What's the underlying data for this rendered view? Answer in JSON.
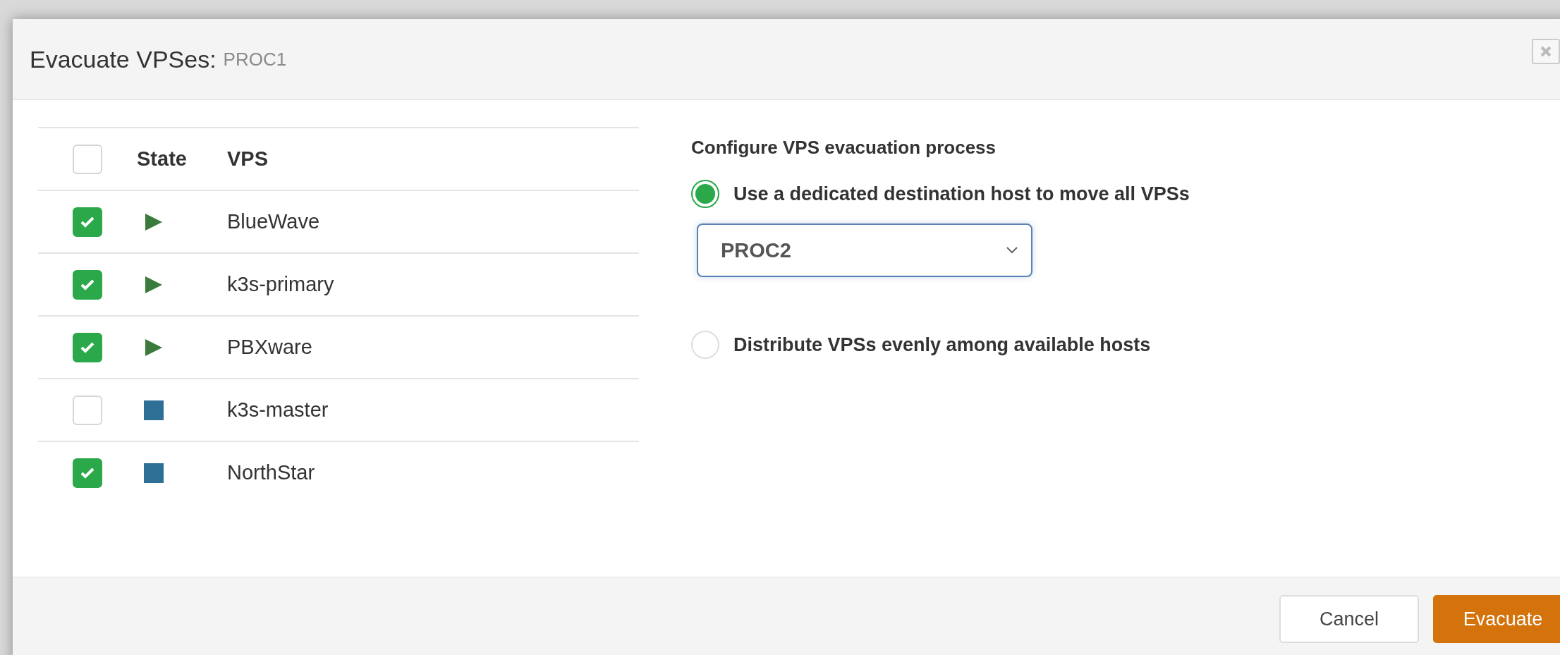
{
  "dialog": {
    "title": "Evacuate VPSes:",
    "subtitle": "PROC1"
  },
  "table": {
    "select_all": {
      "checked": false
    },
    "columns": [
      "State",
      "VPS"
    ],
    "rows": [
      {
        "checked": true,
        "kind": "running",
        "name": "BlueWave"
      },
      {
        "checked": true,
        "kind": "running",
        "name": "k3s-primary"
      },
      {
        "checked": true,
        "kind": "running",
        "name": "PBXware"
      },
      {
        "checked": false,
        "kind": "stopped",
        "name": "k3s-master"
      },
      {
        "checked": true,
        "kind": "stopped",
        "name": "NorthStar"
      }
    ]
  },
  "config": {
    "heading": "Configure VPS evacuation process",
    "options": [
      {
        "label": "Use a dedicated destination host to move all VPSs",
        "selected": true,
        "kind": "select",
        "value": "PROC2"
      },
      {
        "label": "Distribute VPSs evenly among available hosts",
        "selected": false,
        "kind": "plain"
      }
    ]
  },
  "buttons": [
    {
      "label": "Cancel",
      "kind": "secondary"
    },
    {
      "label": "Evacuate",
      "kind": "primary"
    }
  ]
}
